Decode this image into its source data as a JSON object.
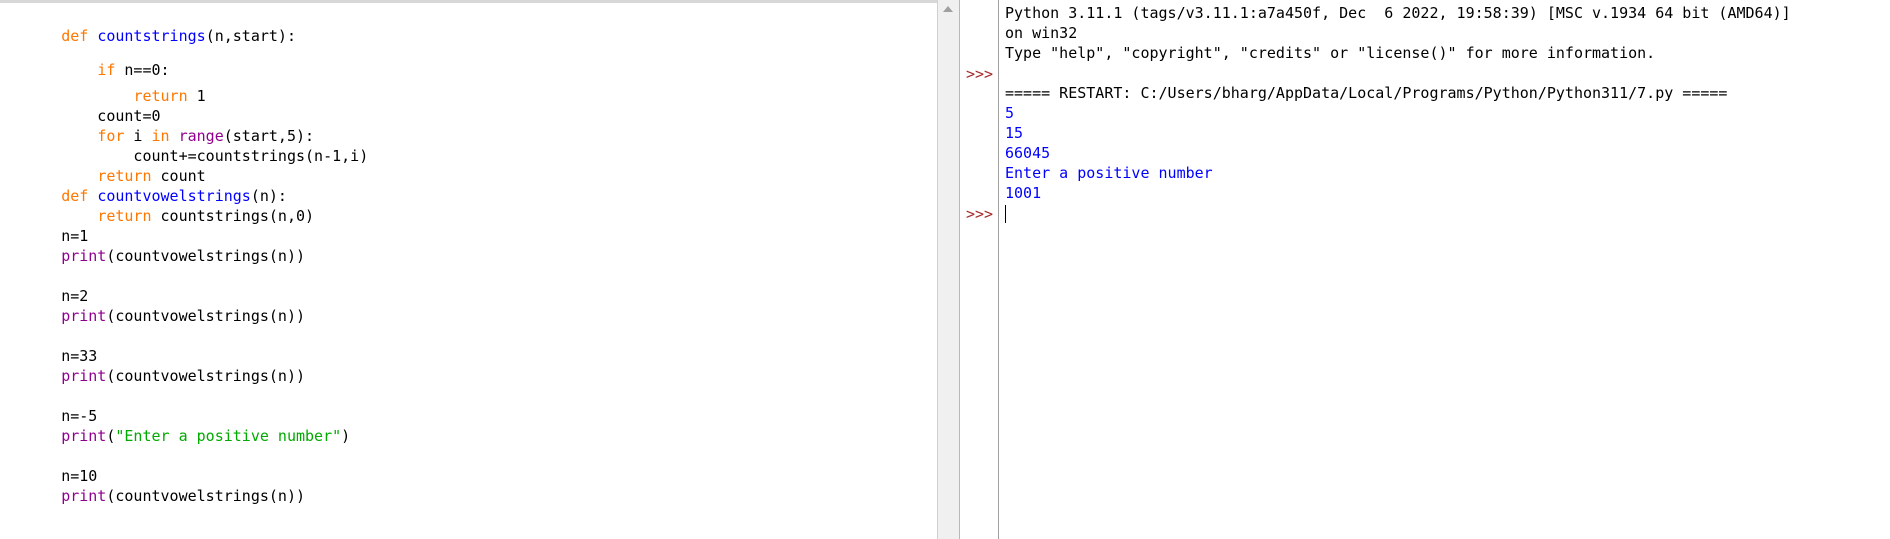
{
  "editor": {
    "lines": [
      [
        "def",
        " ",
        "countstrings",
        "(n,start):"
      ],
      [
        ""
      ],
      [
        "    ",
        "if",
        " n==0:"
      ],
      [
        "        ",
        "return",
        " 1"
      ],
      [
        "    count=0"
      ],
      [
        "    ",
        "for",
        " i ",
        "in",
        " ",
        "range",
        "(start,5):"
      ],
      [
        "        count+=countstrings(n-1,i)"
      ],
      [
        "    ",
        "return",
        " count"
      ],
      [
        "def",
        " ",
        "countvowelstrings",
        "(n):"
      ],
      [
        "    ",
        "return",
        " countstrings(n,0)"
      ],
      [
        "n=1"
      ],
      [
        "print",
        "(countvowelstrings(n))"
      ],
      [
        ""
      ],
      [
        "n=2"
      ],
      [
        "print",
        "(countvowelstrings(n))"
      ],
      [
        ""
      ],
      [
        "n=33"
      ],
      [
        "print",
        "(countvowelstrings(n))"
      ],
      [
        ""
      ],
      [
        "n=-5"
      ],
      [
        "print",
        "(",
        "\"Enter a positive number\"",
        ")"
      ],
      [
        ""
      ],
      [
        "n=10"
      ],
      [
        "print",
        "(countvowelstrings(n))"
      ]
    ]
  },
  "shell": {
    "banner_line1": "Python 3.11.1 (tags/v3.11.1:a7a450f, Dec  6 2022, 19:58:39) [MSC v.1934 64 bit (AMD64)]",
    "banner_line2": "on win32",
    "banner_line3": "Type \"help\", \"copyright\", \"credits\" or \"license()\" for more information.",
    "restart_line": "===== RESTART: C:/Users/bharg/AppData/Local/Programs/Python/Python311/7.py =====",
    "outputs": [
      "5",
      "15",
      "66045",
      "Enter a positive number",
      "1001"
    ],
    "prompt": ">>>"
  }
}
